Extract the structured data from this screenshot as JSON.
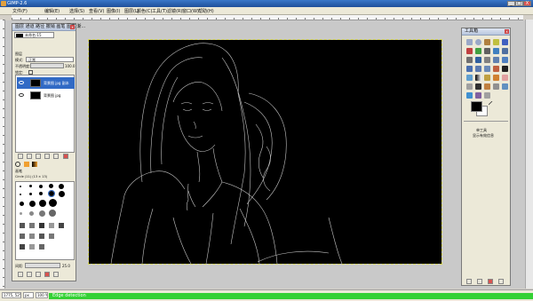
{
  "window": {
    "title": "GIMP-2.6",
    "controls": [
      "_",
      "□",
      "X"
    ]
  },
  "menubar": {
    "items": [
      "文件(F)",
      "编辑(E)",
      "选择(S)",
      "查看(V)",
      "图像(I)",
      "图层(L)",
      "颜色(C)",
      "工具(T)",
      "滤镜(R)",
      "窗口(W)",
      "帮助(H)"
    ]
  },
  "layers_dock": {
    "tabs_label": "图层 通道 路径 撤销 画笔 图案 渐...",
    "image_selector": "未命名-15",
    "panel_title": "图层",
    "mode_label": "模式:",
    "mode_value": "正常",
    "opacity_label": "不透明度:",
    "opacity_value": "100.0",
    "lock_label": "锁定:",
    "layers": [
      {
        "name": "背景图 jpg 副本",
        "selected": true
      },
      {
        "name": "背景图 jpg",
        "selected": false
      }
    ],
    "brushes_title": "画笔",
    "brush_name": "Circle (11) (13 × 13)",
    "spacing_label": "间距:",
    "spacing_value": "25.0"
  },
  "toolbox": {
    "title": "工具箱",
    "options_label1": "单工具",
    "options_label2": "显示有效信息"
  },
  "statusbar": {
    "coords": "1775, 525",
    "unit": "px",
    "zoom": "100 %",
    "message": "Edge detection"
  },
  "colors": {
    "foreground": "#000000",
    "background": "#ffffff",
    "progress": "#34d134"
  }
}
